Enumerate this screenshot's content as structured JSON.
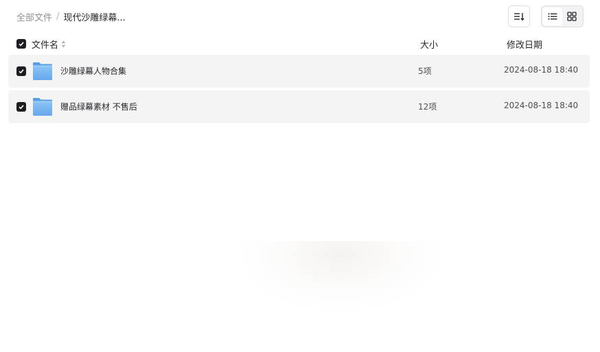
{
  "breadcrumb": {
    "root": "全部文件",
    "separator": "/",
    "current": "现代沙雕绿幕..."
  },
  "toolbar": {
    "sort_icon": "sort-list-icon",
    "view_list_icon": "list-view-icon",
    "view_grid_icon": "grid-view-icon",
    "active_view": "list"
  },
  "list_header": {
    "name": "文件名",
    "size": "大小",
    "date": "修改日期"
  },
  "rows": [
    {
      "name": "沙雕绿幕人物合集",
      "size": "5项",
      "date": "2024-08-18 18:40",
      "icon": "folder-icon",
      "checked": true
    },
    {
      "name": "赠品绿幕素材 不售后",
      "size": "12项",
      "date": "2024-08-18 18:40",
      "icon": "folder-icon",
      "checked": true
    }
  ],
  "colors": {
    "folder": "#79b6f0",
    "row_bg": "#f4f4f5",
    "checkbox": "#1d1e22"
  }
}
